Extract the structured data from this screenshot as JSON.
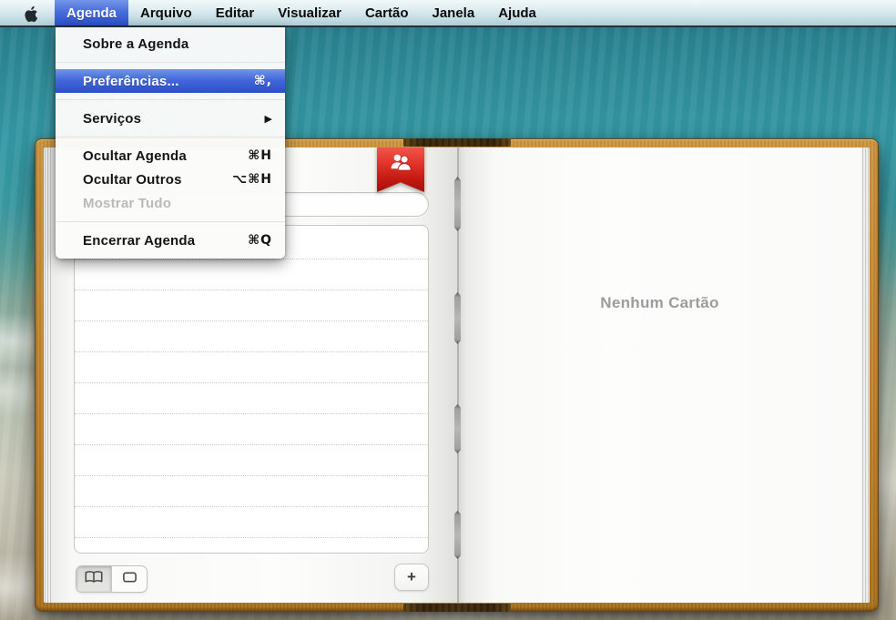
{
  "menubar": {
    "items": [
      {
        "label": "Agenda",
        "selected": true
      },
      {
        "label": "Arquivo"
      },
      {
        "label": "Editar"
      },
      {
        "label": "Visualizar"
      },
      {
        "label": "Cartão"
      },
      {
        "label": "Janela"
      },
      {
        "label": "Ajuda"
      }
    ]
  },
  "menu": {
    "items": [
      {
        "label": "Sobre a Agenda"
      },
      {
        "label": "Preferências...",
        "shortcut": "⌘,",
        "highlighted": true
      },
      {
        "label": "Serviços",
        "arrow": "▶"
      },
      {
        "label": "Ocultar Agenda",
        "shortcut": "⌘H"
      },
      {
        "label": "Ocultar Outros",
        "shortcut": "⌥⌘H"
      },
      {
        "label": "Mostrar Tudo",
        "disabled": true
      },
      {
        "label": "Encerrar Agenda",
        "shortcut": "⌘Q"
      }
    ]
  },
  "window": {
    "empty_message": "Nenhum Cartão",
    "add_button_label": "+",
    "search": {
      "value": "",
      "placeholder": ""
    },
    "view_toggle": {
      "selected": "book-view"
    },
    "bookmark_icon": "group-contacts",
    "list_rows": 11
  },
  "colors": {
    "menu_highlight_blue": "#2a4fcb",
    "bookmark_red": "#c01710",
    "leather_brown": "#c08531",
    "menubar_shadow": "#20333a"
  }
}
